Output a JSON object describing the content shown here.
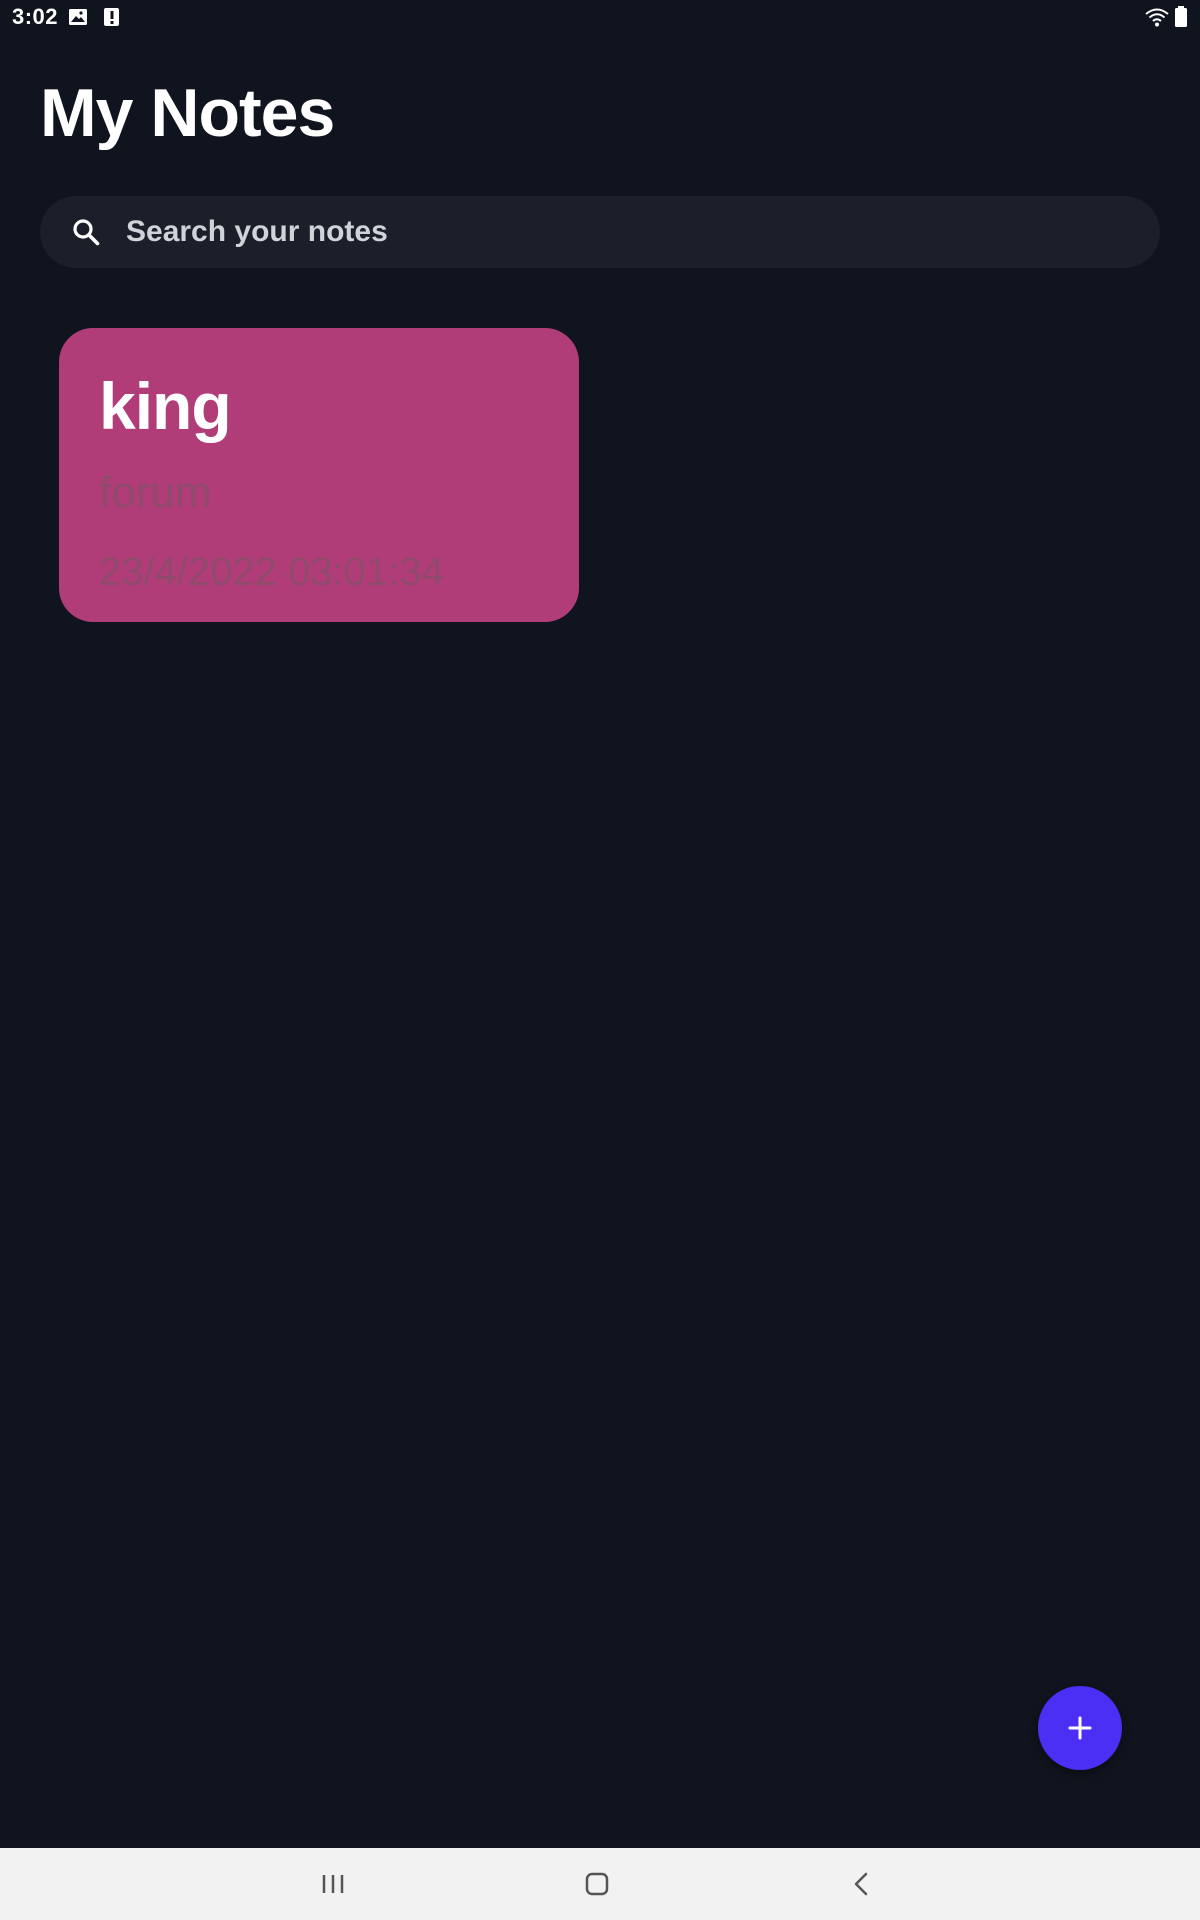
{
  "status_bar": {
    "time": "3:02",
    "icons": [
      "gallery-icon",
      "alert-icon",
      "wifi-icon",
      "battery-icon"
    ]
  },
  "header": {
    "title": "My Notes"
  },
  "search": {
    "placeholder": "Search your notes",
    "value": ""
  },
  "notes": [
    {
      "title": "king",
      "subtitle": "forum",
      "date": "23/4/2022 03:01:34",
      "color": "#b03d78"
    }
  ],
  "fab": {
    "icon": "plus-icon",
    "color": "#4c2ff5"
  },
  "nav_bar": {
    "buttons": [
      "recents-icon",
      "home-icon",
      "back-icon"
    ]
  },
  "colors": {
    "background": "#10141e",
    "search_background": "#1a1f2a",
    "nav_background": "#f2f2f2"
  }
}
